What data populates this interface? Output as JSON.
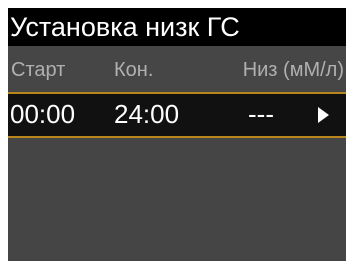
{
  "title": "Установка низк ГС",
  "columns": {
    "start": "Старт",
    "end": "Кон.",
    "low": "Низ (мМ/л)"
  },
  "rows": [
    {
      "start": "00:00",
      "end": "24:00",
      "low": "---",
      "action_icon": "play-arrow-icon"
    }
  ],
  "colors": {
    "background": "#454545",
    "title_bar": "#000000",
    "selected_row": "#111111",
    "accent": "#b8861b",
    "text": "#ffffff",
    "muted_text": "#b0b0b0"
  }
}
